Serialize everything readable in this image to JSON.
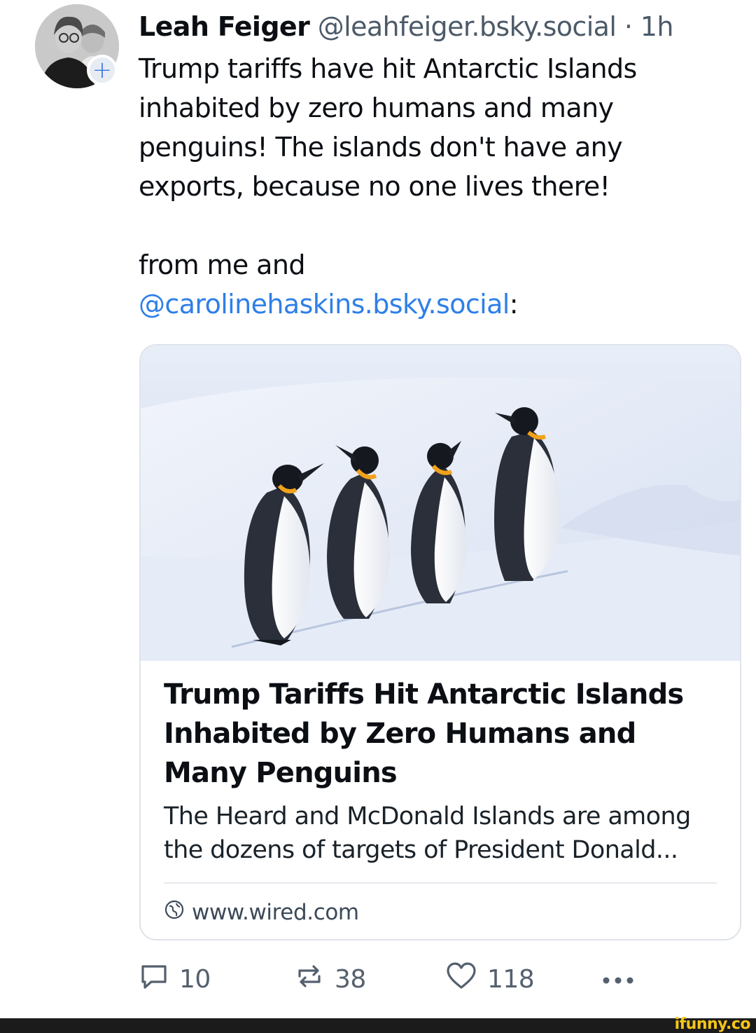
{
  "post": {
    "author_name": "Leah Feiger",
    "handle": "@leahfeiger.bsky.social",
    "separator": " · ",
    "time": "1h",
    "text_paragraph_1": "Trump tariffs have hit Antarctic Islands inhabited by zero humans and many penguins! The islands don't have any exports, because no one lives there!",
    "text_paragraph_2_prefix": "from me and ",
    "text_paragraph_2_mention": "@carolinehaskins.bsky.social",
    "text_paragraph_2_suffix": ":",
    "follow_icon": "plus-icon"
  },
  "link_card": {
    "image_description_icon": "penguins-on-snow-image",
    "title": "Trump Tariffs Hit Antarctic Islands Inhabited by Zero Humans and Many Penguins",
    "description": "The Heard and McDonald Islands are among the dozens of targets of President Donald...",
    "domain": "www.wired.com",
    "domain_icon": "globe-icon"
  },
  "actions": {
    "replies": "10",
    "reposts": "38",
    "likes": "118",
    "reply_icon": "comment-icon",
    "repost_icon": "repost-icon",
    "like_icon": "heart-icon",
    "more_icon": "more-dots-icon"
  },
  "watermark": {
    "text": "ifunny.co"
  },
  "colors": {
    "mention": "#2e7fe8",
    "text": "#0b0f14",
    "muted": "#4c5a68",
    "border": "#dfe4ea",
    "watermark": "#f5c518"
  }
}
